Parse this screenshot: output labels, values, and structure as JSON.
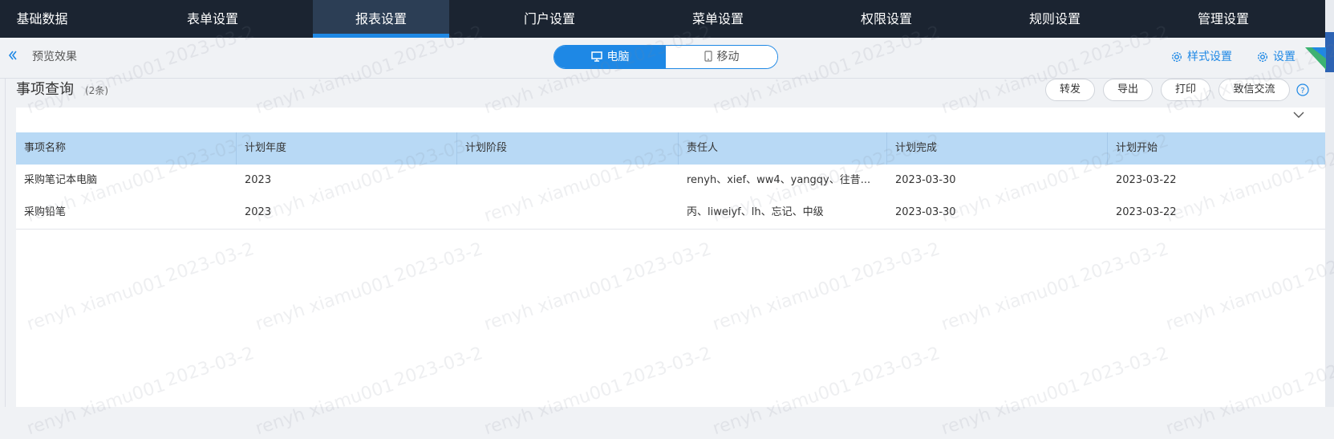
{
  "nav": {
    "items": [
      {
        "label": "基础数据"
      },
      {
        "label": "表单设置"
      },
      {
        "label": "报表设置"
      },
      {
        "label": "门户设置"
      },
      {
        "label": "菜单设置"
      },
      {
        "label": "权限设置"
      },
      {
        "label": "规则设置"
      },
      {
        "label": "管理设置"
      }
    ],
    "active_index": 2
  },
  "toolbar": {
    "preview_label": "预览效果",
    "device_pc": "电脑",
    "device_mobile": "移动",
    "style_settings": "样式设置",
    "settings": "设置"
  },
  "report": {
    "title": "事项查询",
    "count": "(2条)",
    "actions": {
      "forward": "转发",
      "export": "导出",
      "print": "打印",
      "message": "致信交流"
    }
  },
  "table": {
    "columns": [
      "事项名称",
      "计划年度",
      "计划阶段",
      "责任人",
      "计划完成",
      "计划开始"
    ],
    "rows": [
      [
        "采购笔记本电脑",
        "2023",
        "",
        "renyh、xief、ww4、yangqy、往昔...",
        "2023-03-30",
        "2023-03-22"
      ],
      [
        "采购铅笔",
        "2023",
        "",
        "丙、liweiyf、lh、忘记、中级",
        "2023-03-30",
        "2023-03-22"
      ]
    ]
  },
  "watermark": {
    "user": "renyh xiamu001",
    "date": "2023-03-2"
  },
  "colors": {
    "nav_bg": "#1b2431",
    "accent": "#1e88e5",
    "table_header": "#b8d9f5"
  }
}
